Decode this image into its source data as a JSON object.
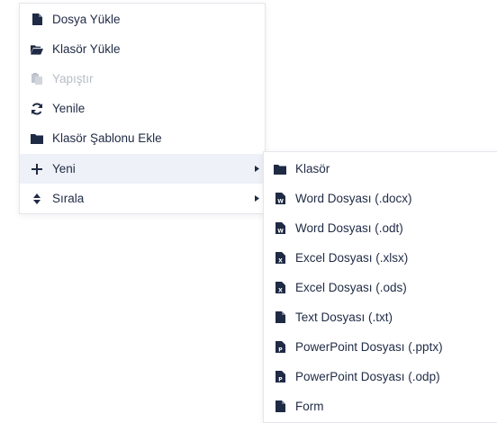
{
  "main_menu": {
    "items": [
      {
        "label": "Dosya Yükle",
        "icon": "file-upload-icon",
        "disabled": false
      },
      {
        "label": "Klasör Yükle",
        "icon": "folder-open-icon",
        "disabled": false
      },
      {
        "label": "Yapıştır",
        "icon": "paste-icon",
        "disabled": true
      },
      {
        "label": "Yenile",
        "icon": "refresh-icon",
        "disabled": false
      },
      {
        "label": "Klasör Şablonu Ekle",
        "icon": "folder-icon",
        "disabled": false
      },
      {
        "label": "Yeni",
        "icon": "plus-icon",
        "has_submenu": true,
        "active": true
      },
      {
        "label": "Sırala",
        "icon": "sort-icon",
        "has_submenu": true
      }
    ]
  },
  "sub_menu": {
    "items": [
      {
        "label": "Klasör",
        "icon": "folder-icon"
      },
      {
        "label": "Word Dosyası (.docx)",
        "icon": "word-file-icon",
        "badge": "W"
      },
      {
        "label": "Word Dosyası (.odt)",
        "icon": "word-file-icon",
        "badge": "W"
      },
      {
        "label": "Excel Dosyası (.xlsx)",
        "icon": "excel-file-icon",
        "badge": "X"
      },
      {
        "label": "Excel Dosyası (.ods)",
        "icon": "excel-file-icon",
        "badge": "X"
      },
      {
        "label": "Text Dosyası (.txt)",
        "icon": "text-file-icon"
      },
      {
        "label": "PowerPoint Dosyası (.pptx)",
        "icon": "powerpoint-file-icon",
        "badge": "P"
      },
      {
        "label": "PowerPoint Dosyası (.odp)",
        "icon": "powerpoint-file-icon",
        "badge": "P"
      },
      {
        "label": "Form",
        "icon": "form-file-icon"
      }
    ]
  },
  "colors": {
    "text": "#1f2a44",
    "disabled": "#b8bcc6",
    "active_bg": "#eef1f7",
    "border": "#e3e6ec"
  }
}
